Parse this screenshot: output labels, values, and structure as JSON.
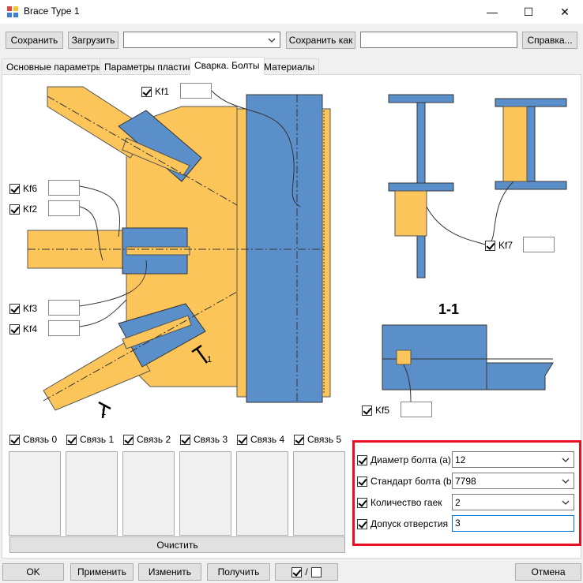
{
  "window": {
    "title": "Brace Type 1",
    "min": "—",
    "max": "☐",
    "close": "✕"
  },
  "toolbar": {
    "save": "Сохранить",
    "load": "Загрузить",
    "preset_value": "",
    "save_as": "Сохранить как",
    "save_as_name": "",
    "help": "Справка..."
  },
  "tabs": [
    "Основные параметры",
    "Параметры пластин",
    "Сварка. Болты",
    "Материалы"
  ],
  "drawing": {
    "welds": {
      "kf1": "Kf1",
      "kf2": "Kf2",
      "kf3": "Kf3",
      "kf4": "Kf4",
      "kf5": "Kf5",
      "kf6": "Kf6",
      "kf7": "Kf7"
    },
    "section_label": "1-1",
    "section_mark_a": "1",
    "section_mark_b": "1"
  },
  "braces": [
    "Связь 0",
    "Связь 1",
    "Связь 2",
    "Связь 3",
    "Связь 4",
    "Связь 5"
  ],
  "clear": "Очистить",
  "bolts": {
    "diameter_label": "Диаметр болта (a)",
    "diameter_value": "12",
    "standard_label": "Стандарт болта (b)",
    "standard_value": "7798",
    "nuts_label": "Количество гаек",
    "nuts_value": "2",
    "tolerance_label": "Допуск отверстия",
    "tolerance_value": "3"
  },
  "bottom": {
    "ok": "OK",
    "apply": "Применить",
    "modify": "Изменить",
    "get": "Получить",
    "toggle_sep": "/",
    "cancel": "Отмена"
  },
  "colors": {
    "steel": "#5b8fc9",
    "plate": "#fcc55a",
    "highlight": "#e81123"
  }
}
